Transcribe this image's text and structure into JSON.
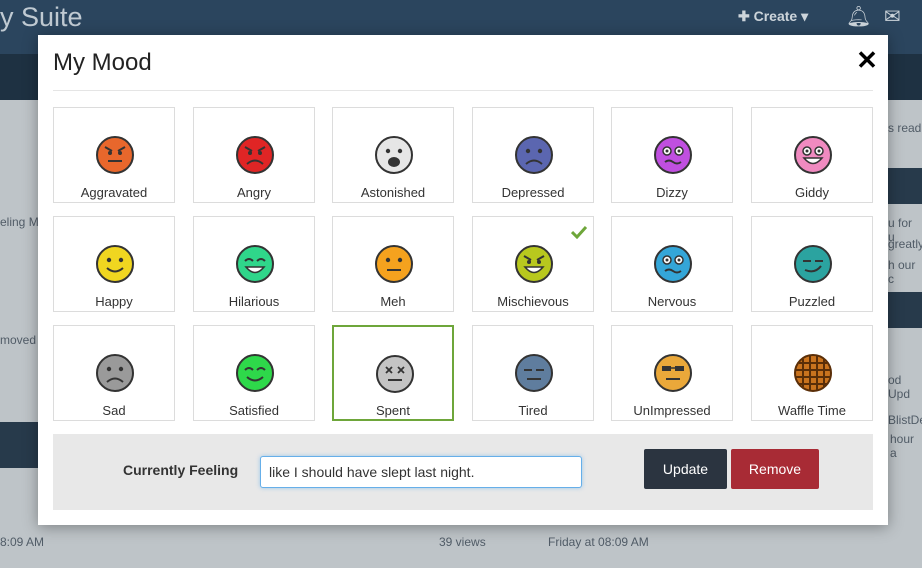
{
  "background": {
    "brand": "y Suite",
    "create_label": "Create",
    "left_texts": [
      "eling M",
      "moved",
      "8:09 AM"
    ],
    "right_texts": [
      "s read",
      "u for u",
      "greatly",
      "h our c",
      "od Upd",
      "BlistDe",
      "hour a"
    ],
    "stats": {
      "views": "39 views",
      "time": "Friday at 08:09 AM"
    }
  },
  "modal": {
    "title": "My Mood",
    "close_label": "✕",
    "moods": [
      {
        "label": "Aggravated",
        "color": "#e8672c",
        "face": "aggravated"
      },
      {
        "label": "Angry",
        "color": "#e02525",
        "face": "angry"
      },
      {
        "label": "Astonished",
        "color": "#e6e6e6",
        "face": "astonished"
      },
      {
        "label": "Depressed",
        "color": "#5b66b0",
        "face": "depressed"
      },
      {
        "label": "Dizzy",
        "color": "#c04fe0",
        "face": "dizzy"
      },
      {
        "label": "Giddy",
        "color": "#f08ac0",
        "face": "giddy"
      },
      {
        "label": "Happy",
        "color": "#f0d620",
        "face": "happy"
      },
      {
        "label": "Hilarious",
        "color": "#2fd68a",
        "face": "hilarious"
      },
      {
        "label": "Meh",
        "color": "#f5a21e",
        "face": "meh"
      },
      {
        "label": "Mischievous",
        "color": "#b8c81e",
        "face": "mischievous",
        "checked": true
      },
      {
        "label": "Nervous",
        "color": "#34a6d8",
        "face": "nervous"
      },
      {
        "label": "Puzzled",
        "color": "#2ba3a0",
        "face": "puzzled"
      },
      {
        "label": "Sad",
        "color": "#9a9a9a",
        "face": "sad"
      },
      {
        "label": "Satisfied",
        "color": "#2ed84a",
        "face": "satisfied"
      },
      {
        "label": "Spent",
        "color": "#c4c4c4",
        "face": "spent",
        "selected": true
      },
      {
        "label": "Tired",
        "color": "#5f7d9e",
        "face": "tired"
      },
      {
        "label": "UnImpressed",
        "color": "#eaa83a",
        "face": "unimpressed"
      },
      {
        "label": "Waffle Time",
        "color": "#c9731e",
        "face": "waffle"
      }
    ],
    "feeling_label": "Currently Feeling",
    "feeling_value": "like I should have slept last night.",
    "update_label": "Update",
    "remove_label": "Remove"
  }
}
